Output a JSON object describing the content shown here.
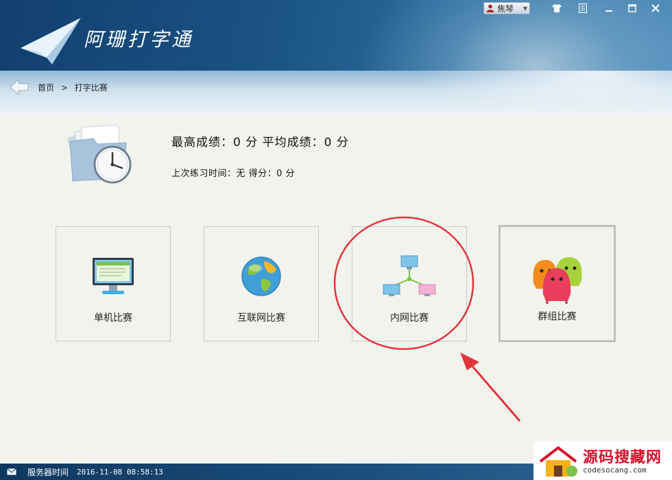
{
  "app": {
    "title": "阿珊打字通"
  },
  "topbar": {
    "username": "焦琴"
  },
  "breadcrumb": {
    "home": "首页",
    "separator": ">",
    "current": "打字比赛"
  },
  "stats": {
    "best_average": "最高成绩：0 分  平均成绩：0 分",
    "last_practice": "上次练习时间：无  得分：0 分"
  },
  "modes": [
    {
      "label": "单机比赛"
    },
    {
      "label": "互联网比赛"
    },
    {
      "label": "内网比赛"
    },
    {
      "label": "群组比赛"
    }
  ],
  "status": {
    "server_time_label": "服务器时间",
    "server_time_value": "2016-11-08 08:58:13"
  },
  "watermark": {
    "title": "源码搜藏网",
    "url": "codesocang.com"
  },
  "colors": {
    "header": "#1a5384",
    "annotation": "#e0353b",
    "tile_border": "#c9c9c9"
  }
}
